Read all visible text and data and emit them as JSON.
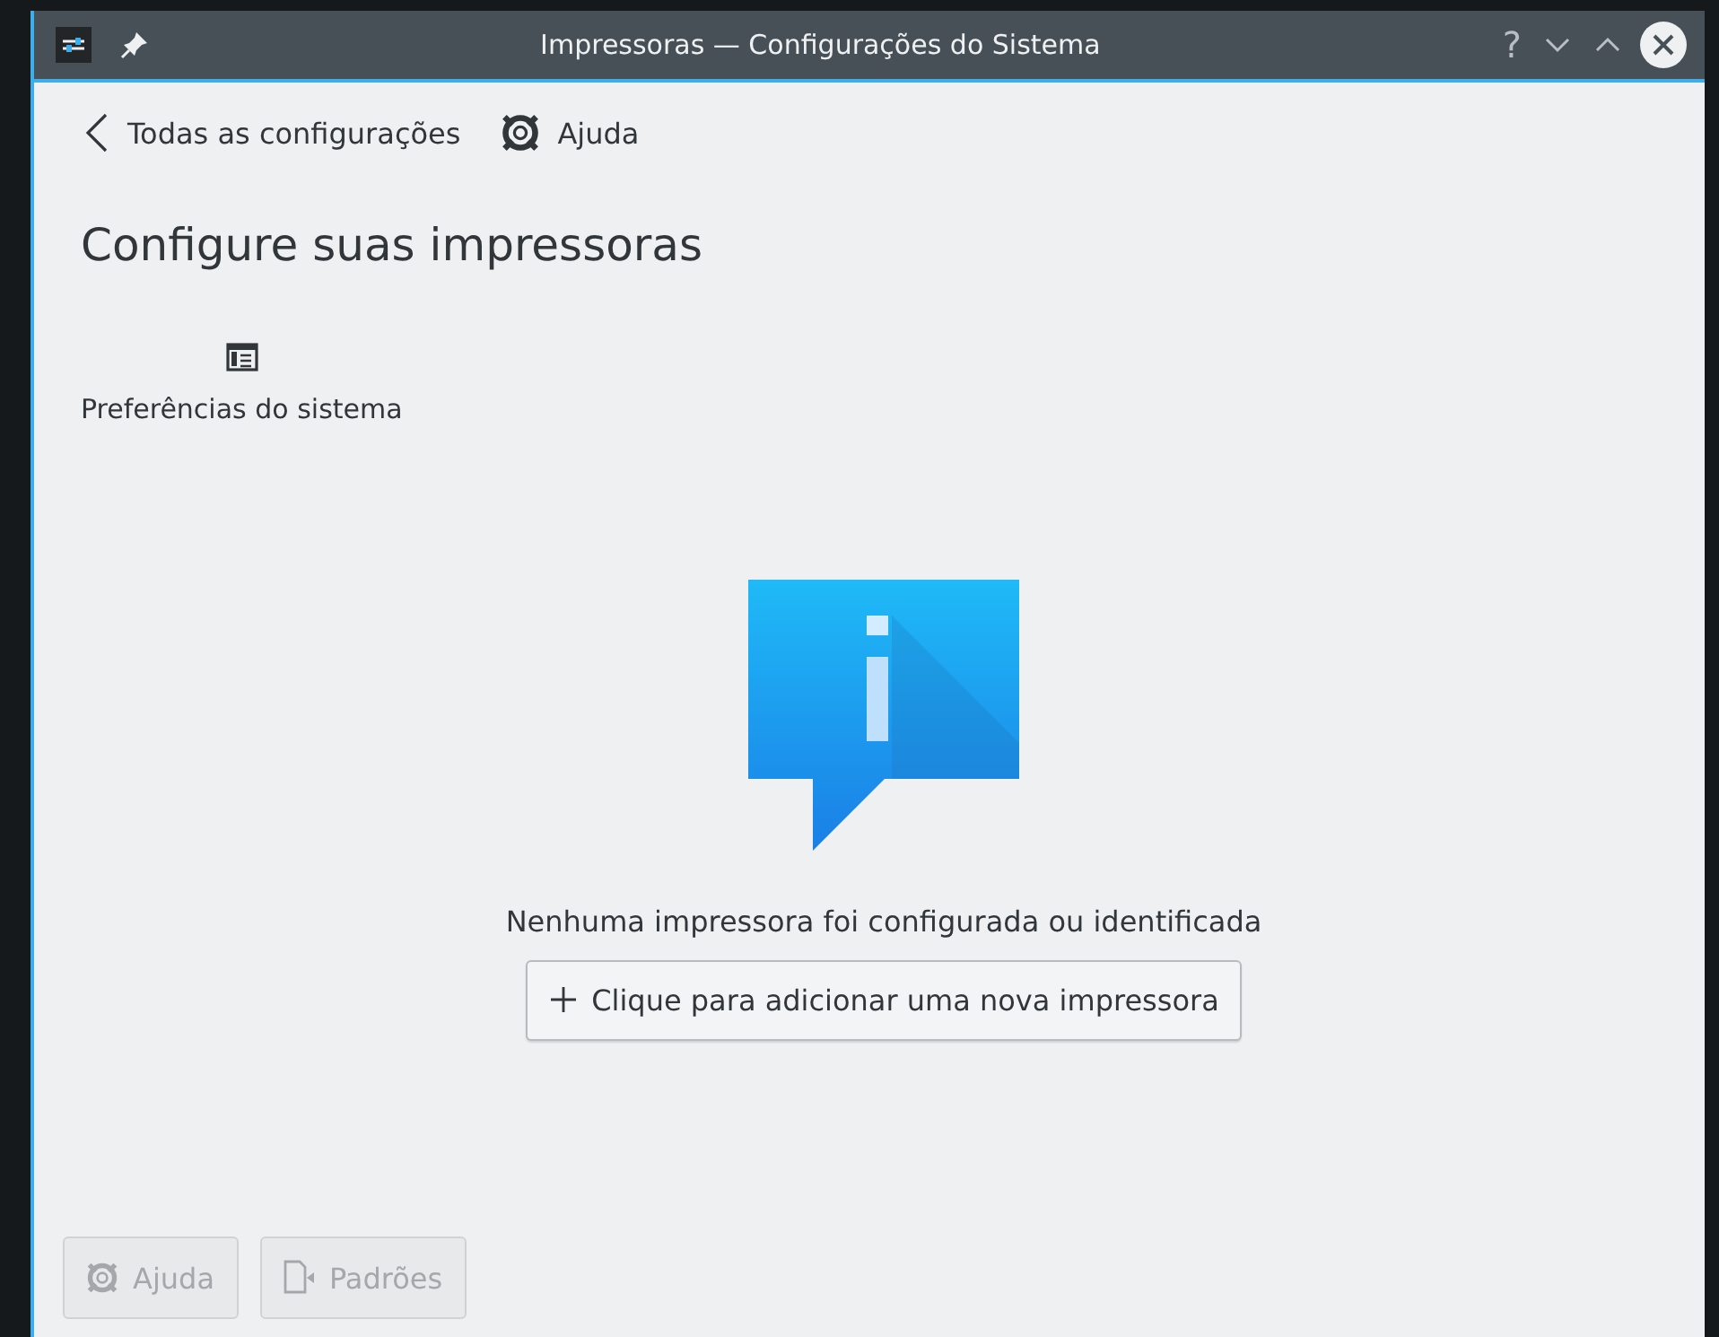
{
  "window": {
    "title": "Impressoras — Configurações do Sistema",
    "controls": [
      "?"
    ]
  },
  "toolbar": {
    "back": {
      "label": "Todas as configurações"
    },
    "help": {
      "label": "Ajuda"
    }
  },
  "heading": "Configure suas impressoras",
  "shortcuts": [
    {
      "label": "Preferências do sistema"
    }
  ],
  "empty_state": {
    "message": "Nenhuma impressora foi configurada ou identificada",
    "button": {
      "label": "Clique para adicionar uma nova impressora"
    }
  },
  "footer_buttons": [
    {
      "kind": "help",
      "label": "Ajuda",
      "disabled": true
    },
    {
      "kind": "defaults",
      "label": "Padrões",
      "disabled": true
    }
  ]
}
